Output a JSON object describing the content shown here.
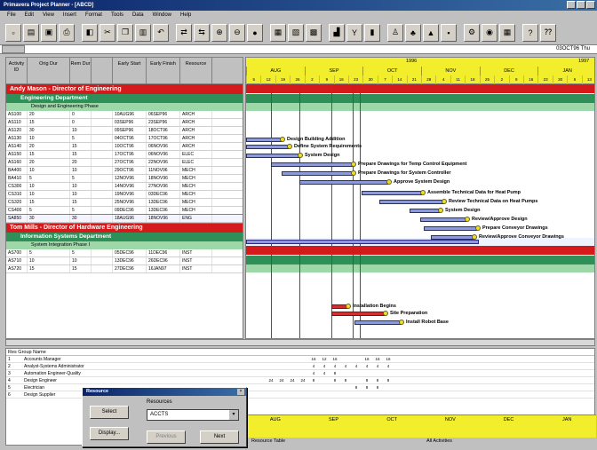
{
  "window": {
    "title": "Primavera Project Planner - [ABCD]"
  },
  "menu": [
    "File",
    "Edit",
    "View",
    "Insert",
    "Format",
    "Tools",
    "Data",
    "Window",
    "Help"
  ],
  "toolbar_icons": [
    "new-icon",
    "open-icon",
    "save-icon",
    "print-icon",
    "preview-icon",
    "cut-icon",
    "copy-icon",
    "paste-icon",
    "undo-icon",
    "link-icon",
    "unlink-icon",
    "zoom-in-icon",
    "zoom-out-icon",
    "bar-icon",
    "table-icon",
    "filter-icon",
    "sort-icon",
    "group-icon",
    "resource-icon",
    "chart-icon",
    "calendar-icon",
    "settings-icon",
    "help-icon"
  ],
  "status": {
    "cell": "",
    "right": "03OCT96 Thu"
  },
  "grid": {
    "columns": [
      "Activity ID",
      "Orig Dur",
      "Rem Dur",
      "Early Start",
      "Early Finish",
      "Resource",
      "",
      ""
    ],
    "groups": [
      {
        "title": "Andy Mason - Director of Engineering",
        "department": "Engineering Department",
        "phase": "Design and Engineering Phase",
        "rows": [
          [
            "AS100",
            "20",
            "0",
            "10AUG96",
            "06SEP96",
            "ARCH",
            "",
            ""
          ],
          [
            "AS110",
            "15",
            "0",
            "03SEP96",
            "23SEP96",
            "ARCH",
            "",
            ""
          ],
          [
            "AS120",
            "30",
            "10",
            "09SEP96",
            "18OCT96",
            "ARCH",
            "",
            ""
          ],
          [
            "AS130",
            "10",
            "5",
            "04OCT96",
            "17OCT96",
            "ARCH",
            "",
            ""
          ],
          [
            "AS140",
            "20",
            "15",
            "10OCT96",
            "06NOV96",
            "ARCH",
            "",
            ""
          ],
          [
            "AS150",
            "15",
            "15",
            "17OCT96",
            "06NOV96",
            "ELEC",
            "",
            ""
          ],
          [
            "AS160",
            "20",
            "20",
            "27OCT96",
            "22NOV96",
            "ELEC",
            "",
            ""
          ],
          [
            "BA400",
            "10",
            "10",
            "29OCT96",
            "11NOV96",
            "MECH",
            "",
            ""
          ],
          [
            "BA410",
            "5",
            "5",
            "12NOV96",
            "18NOV96",
            "MECH",
            "",
            ""
          ],
          [
            "CS300",
            "10",
            "10",
            "14NOV96",
            "27NOV96",
            "MECH",
            "",
            ""
          ],
          [
            "CS310",
            "10",
            "10",
            "19NOV96",
            "03DEC96",
            "MECH",
            "",
            ""
          ],
          [
            "CS320",
            "15",
            "15",
            "25NOV96",
            "13DEC96",
            "MECH",
            "",
            ""
          ],
          [
            "CS400",
            "5",
            "5",
            "09DEC96",
            "13DEC96",
            "MECH",
            "",
            ""
          ]
        ],
        "selected_row": [
          "SA850",
          "30",
          "30",
          "18AUG96",
          "18NOV96",
          "ENG",
          "",
          ""
        ]
      },
      {
        "title": "Tom Mills - Director of Hardware Engineering",
        "department": "Information Systems Department",
        "phase": "System Integration Phase I",
        "rows": [
          [
            "AS700",
            "5",
            "5",
            "05DEC96",
            "11DEC96",
            "INST",
            "",
            ""
          ],
          [
            "AS710",
            "10",
            "10",
            "13DEC96",
            "26DEC96",
            "INST",
            "",
            ""
          ],
          [
            "AS720",
            "15",
            "15",
            "27DEC96",
            "16JAN97",
            "INST",
            "",
            ""
          ]
        ]
      }
    ]
  },
  "gantt": {
    "year": "1996",
    "year_next": "1997",
    "months": [
      "AUG",
      "SEP",
      "OCT",
      "NOV",
      "DEC",
      "JAN"
    ],
    "days": [
      "5",
      "12",
      "19",
      "26",
      "2",
      "9",
      "16",
      "23",
      "30",
      "7",
      "14",
      "21",
      "28",
      "4",
      "11",
      "18",
      "25",
      "2",
      "9",
      "16",
      "23",
      "30",
      "6",
      "13"
    ],
    "labels": [
      "Design Building Addition",
      "Define System Requirements",
      "System Design",
      "Prepare Drawings for Temp Control Equipment",
      "Prepare Drawings for System Controller",
      "Approve System Design",
      "Assemble Technical Data for Heat Pump",
      "Review Technical Data on Heat Pumps",
      "System Design",
      "Review/Approve Design",
      "Prepare Conveyor Drawings",
      "Review/Approve Conveyor Drawings",
      "Installation Begins",
      "Site Preparation",
      "Install Robot Base"
    ]
  },
  "resources": {
    "header": "Res  Group Name",
    "rows": [
      {
        "no": "1",
        "name": "Accounts Manager",
        "cells": [
          "",
          "",
          "",
          "",
          "",
          "",
          "16",
          "12",
          "16",
          "",
          "",
          "16",
          "16",
          "16"
        ]
      },
      {
        "no": "2",
        "name": "Analyst-Systems Administrator",
        "cells": [
          "",
          "",
          "",
          "",
          "",
          "",
          "4",
          "4",
          "4",
          "4",
          "4",
          "4",
          "4",
          "4"
        ]
      },
      {
        "no": "3",
        "name": "Automation Engineer-Quality",
        "cells": [
          "",
          "",
          "",
          "",
          "",
          "",
          "4",
          "4",
          "8",
          "",
          "",
          "",
          "",
          ""
        ]
      },
      {
        "no": "4",
        "name": "Design Engineer",
        "cells": [
          "",
          "",
          "24",
          "24",
          "24",
          "24",
          "8",
          "",
          "8",
          "8",
          "",
          "8",
          "8",
          "8"
        ]
      },
      {
        "no": "5",
        "name": "Electrician",
        "cells": [
          "",
          "",
          "",
          "",
          "",
          "",
          "",
          "",
          "",
          "",
          "8",
          "8",
          "8",
          ""
        ]
      },
      {
        "no": "6",
        "name": "Design Supplier",
        "cells": [
          "",
          "",
          "",
          "",
          "",
          "",
          "",
          "",
          "",
          "",
          "",
          "",
          "",
          ""
        ]
      }
    ],
    "months": [
      "AUG",
      "SEP",
      "OCT",
      "NOV",
      "DEC",
      "JAN"
    ],
    "status": [
      "Resource Table",
      "All Activities"
    ]
  },
  "dialog": {
    "title": "Resource",
    "select_label": "Select",
    "display_label": "Display...",
    "resource_label": "Resources",
    "resource_value": "ACCTS",
    "previous_label": "Previous",
    "next_label": "Next"
  },
  "colors": {
    "group_banner": "#d41a1a",
    "dept_banner": "#2f8f59",
    "phase_banner": "#9fd8a8",
    "timescale": "#f2ee2c",
    "bar": "#8e9ad8"
  }
}
